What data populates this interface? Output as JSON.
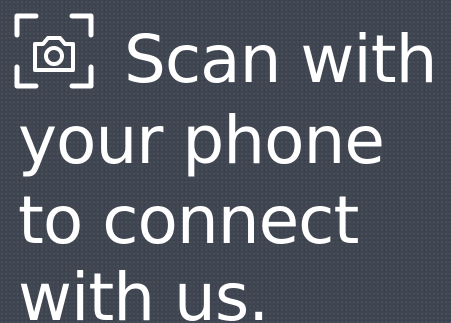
{
  "icons": {
    "scan": "camera-scan-icon"
  },
  "colors": {
    "background": "#3f4651",
    "text": "#ffffff"
  },
  "message": {
    "line_1": "Scan with",
    "line_2": "your phone",
    "line_3": "to connect",
    "line_4": "with us."
  }
}
